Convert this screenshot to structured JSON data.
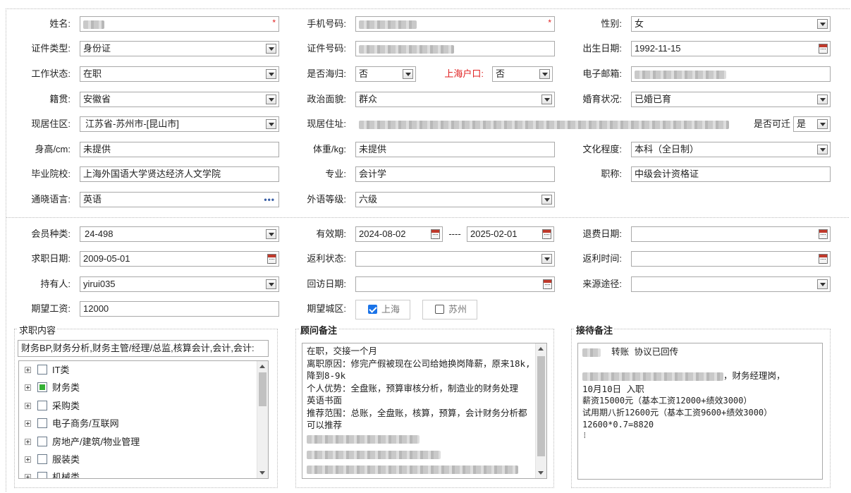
{
  "row1": {
    "name_label": "姓名:",
    "phone_label": "手机号码:",
    "gender_label": "性别:",
    "gender_value": "女"
  },
  "row2": {
    "idtype_label": "证件类型:",
    "idtype_value": "身份证",
    "idno_label": "证件号码:",
    "birth_label": "出生日期:",
    "birth_value": "1992-11-15"
  },
  "row3": {
    "work_label": "工作状态:",
    "work_value": "在职",
    "abroad_label": "是否海归:",
    "abroad_value": "否",
    "hukou_label": "上海户口:",
    "hukou_value": "否",
    "email_label": "电子邮箱:"
  },
  "row4": {
    "native_label": "籍贯:",
    "native_value": "安徽省",
    "political_label": "政治面貌:",
    "political_value": "群众",
    "marital_label": "婚育状况:",
    "marital_value": "已婚已育"
  },
  "row5": {
    "area_label": "现居住区:",
    "area_value": "江苏省-苏州市-[昆山市]",
    "addr_label": "现居住址:",
    "move_label": "是否可迁",
    "move_value": "是"
  },
  "row6": {
    "height_label": "身高/cm:",
    "height_value": "未提供",
    "weight_label": "体重/kg:",
    "weight_value": "未提供",
    "edu_label": "文化程度:",
    "edu_value": "本科（全日制）"
  },
  "row7": {
    "school_label": "毕业院校:",
    "school_value": "上海外国语大学贤达经济人文学院",
    "major_label": "专业:",
    "major_value": "会计学",
    "title_label": "职称:",
    "title_value": "中级会计资格证"
  },
  "row8": {
    "lang_label": "通晓语言:",
    "lang_value": "英语",
    "level_label": "外语等级:",
    "level_value": "六级"
  },
  "row9": {
    "member_label": "会员种类:",
    "member_value": "24-498",
    "valid_label": "有效期:",
    "valid_from": "2024-08-02",
    "valid_sep": "----",
    "valid_to": "2025-02-01",
    "refund_label": "退费日期:"
  },
  "row10": {
    "jobdate_label": "求职日期:",
    "jobdate_value": "2009-05-01",
    "rebate_status_label": "返利状态:",
    "rebate_time_label": "返利时间:"
  },
  "row11": {
    "holder_label": "持有人:",
    "holder_value": "yirui035",
    "visit_label": "回访日期:",
    "source_label": "来源途径:"
  },
  "row12": {
    "salary_label": "期望工资:",
    "salary_value": "12000",
    "city_label": "期望城区:",
    "city_shanghai": "上海",
    "city_suzhou": "苏州"
  },
  "job": {
    "title": "求职内容",
    "selected": "财务BP,财务分析,财务主管/经理/总监,核算会计,会计,会计:",
    "tree": [
      {
        "label": "IT类",
        "checked": false
      },
      {
        "label": "财务类",
        "checked": true
      },
      {
        "label": "采购类",
        "checked": false
      },
      {
        "label": "电子商务/互联网",
        "checked": false
      },
      {
        "label": "房地产/建筑/物业管理",
        "checked": false
      },
      {
        "label": "服装类",
        "checked": false
      },
      {
        "label": "机械类",
        "checked": false
      }
    ]
  },
  "advisor": {
    "title": "顾问备注",
    "lines": [
      "在职，交接一个月",
      "离职原因：修完产假被现在公司给她换岗降薪，原来18k,降到8-9k",
      "个人优势：全盘账，预算审核分析，制造业的财务处理",
      "英语书面",
      "推荐范围：总账，全盘账，核算，预算，会计财务分析都可以推荐"
    ]
  },
  "reception": {
    "title": "接待备注",
    "line1": "转账    协议已回传",
    "line3": "，财务经理岗，",
    "line4": "10月10日 入职",
    "line5": "薪资15000元（基本工资12000+绩效3000）",
    "line6": "试用期八折12600元（基本工资9600+绩效3000）",
    "line7": "12600*0.7=8820"
  }
}
